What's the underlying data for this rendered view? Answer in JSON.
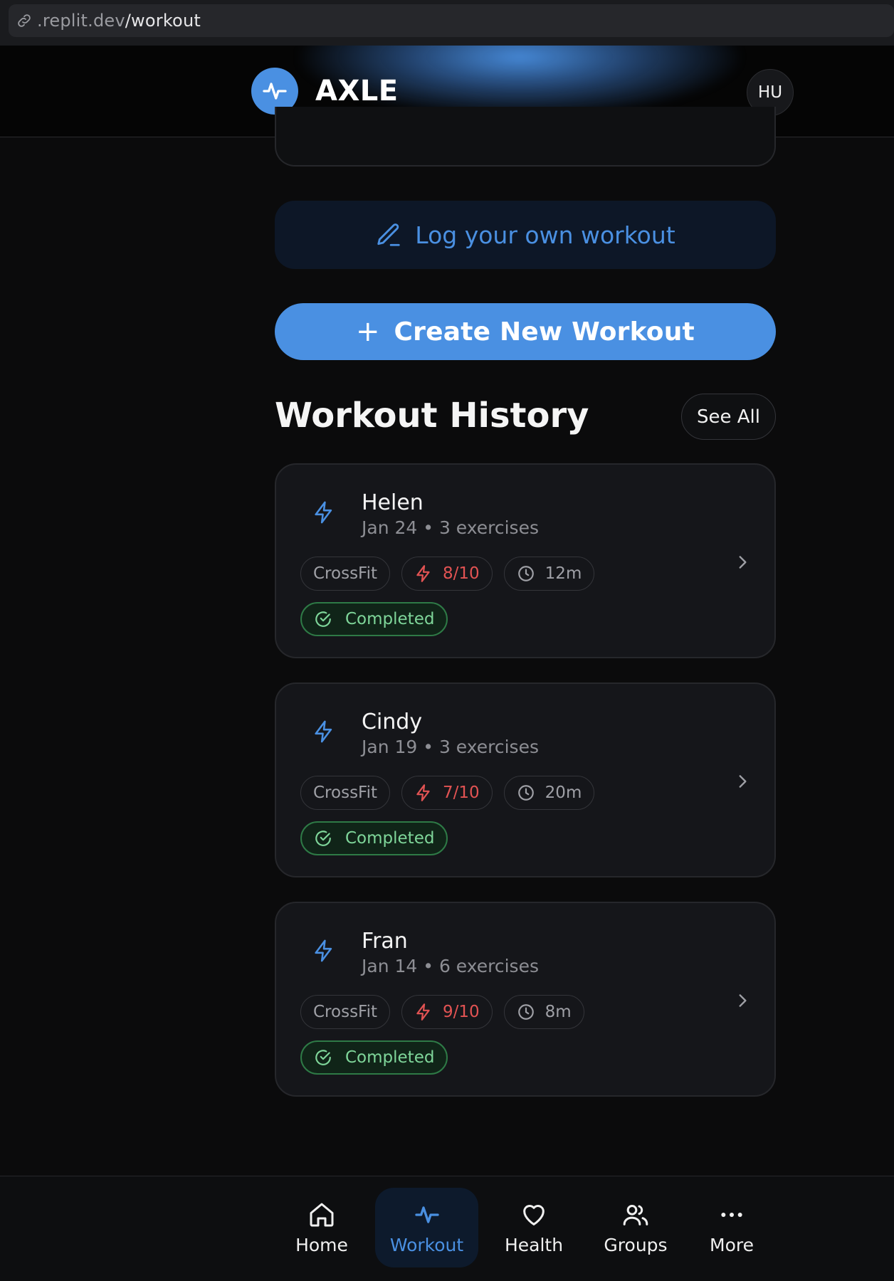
{
  "browser": {
    "url_prefix": ".replit.dev",
    "url_path": "/workout"
  },
  "header": {
    "brand_name": "AXLE",
    "avatar_initials": "HU",
    "logo_icon": "activity-pulse-icon"
  },
  "actions": {
    "log_workout_label": "Log your own workout",
    "create_workout_label": "Create New Workout"
  },
  "history": {
    "title": "Workout History",
    "see_all_label": "See All",
    "items": [
      {
        "name": "Helen",
        "date": "Jan 24",
        "exercises": "3 exercises",
        "type": "CrossFit",
        "intensity": "8/10",
        "duration": "12m",
        "status": "Completed"
      },
      {
        "name": "Cindy",
        "date": "Jan 19",
        "exercises": "3 exercises",
        "type": "CrossFit",
        "intensity": "7/10",
        "duration": "20m",
        "status": "Completed"
      },
      {
        "name": "Fran",
        "date": "Jan 14",
        "exercises": "6 exercises",
        "type": "CrossFit",
        "intensity": "9/10",
        "duration": "8m",
        "status": "Completed"
      }
    ]
  },
  "nav": {
    "items": [
      {
        "label": "Home",
        "icon": "home-icon"
      },
      {
        "label": "Workout",
        "icon": "activity-icon",
        "active": true
      },
      {
        "label": "Health",
        "icon": "heart-icon"
      },
      {
        "label": "Groups",
        "icon": "users-icon"
      },
      {
        "label": "More",
        "icon": "more-dots-icon"
      }
    ]
  },
  "colors": {
    "accent": "#4a90e2",
    "intensity": "#e25353",
    "status_completed": "#7fd69a",
    "background": "#0b0b0c",
    "card": "#15161a"
  }
}
